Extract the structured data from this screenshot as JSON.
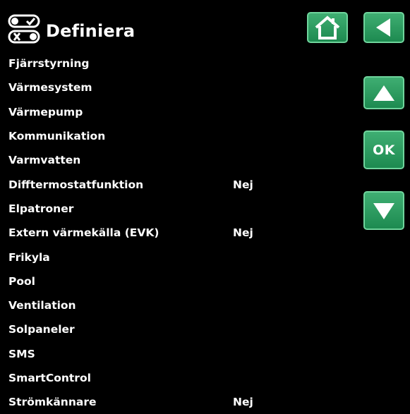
{
  "header": {
    "title": "Definiera",
    "icon": "toggle-switches-icon"
  },
  "nav": {
    "ok_label": "OK",
    "home_icon": "home-icon",
    "back_icon": "back-arrow-icon",
    "up_icon": "up-arrow-icon",
    "down_icon": "down-arrow-icon"
  },
  "colors": {
    "background": "#000000",
    "text": "#ffffff",
    "button_green": "#2a9a5e",
    "button_border": "#6fd49c"
  },
  "menu": {
    "items": [
      {
        "label": "Fjärrstyrning",
        "value": ""
      },
      {
        "label": "Värmesystem",
        "value": ""
      },
      {
        "label": "Värmepump",
        "value": ""
      },
      {
        "label": "Kommunikation",
        "value": ""
      },
      {
        "label": "Varmvatten",
        "value": ""
      },
      {
        "label": "Difftermostatfunktion",
        "value": "Nej"
      },
      {
        "label": "Elpatroner",
        "value": ""
      },
      {
        "label": "Extern värmekälla (EVK)",
        "value": "Nej"
      },
      {
        "label": "Frikyla",
        "value": ""
      },
      {
        "label": "Pool",
        "value": ""
      },
      {
        "label": "Ventilation",
        "value": ""
      },
      {
        "label": "Solpaneler",
        "value": ""
      },
      {
        "label": "SMS",
        "value": ""
      },
      {
        "label": "SmartControl",
        "value": ""
      },
      {
        "label": "Strömkännare",
        "value": "Nej"
      }
    ]
  }
}
